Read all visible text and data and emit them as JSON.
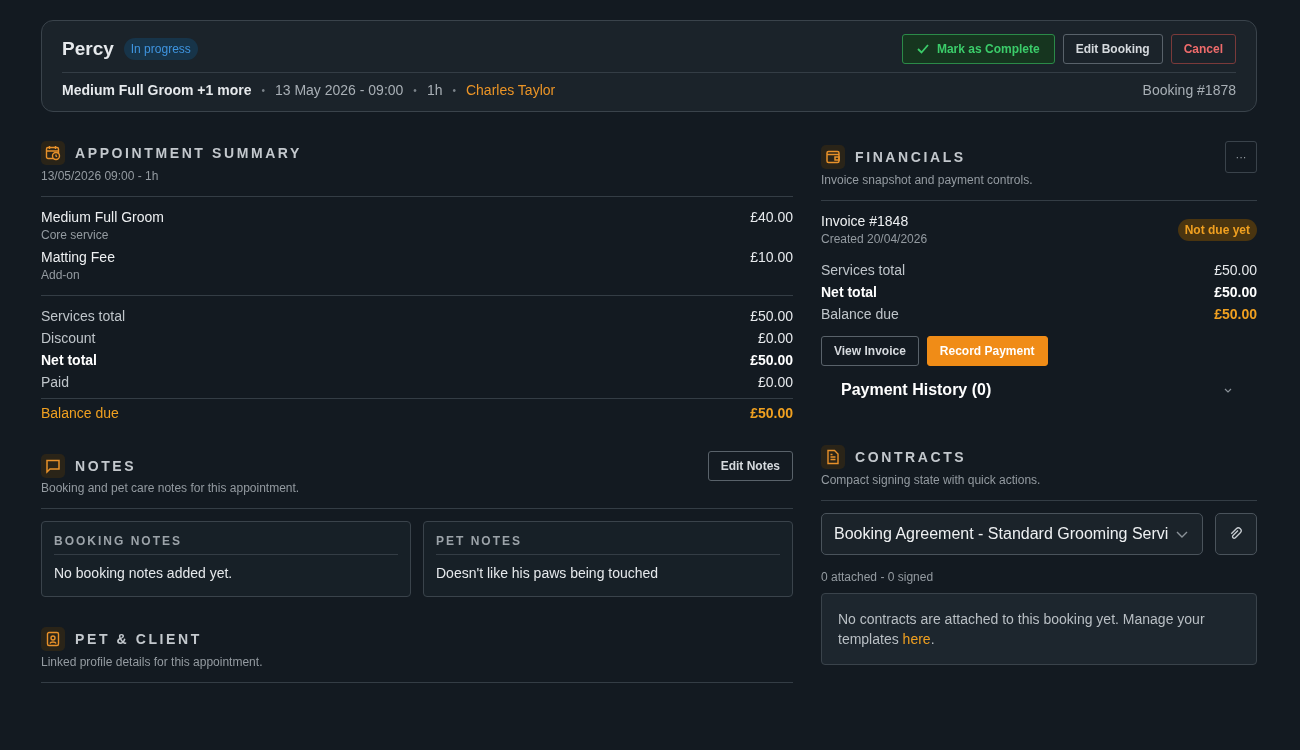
{
  "header": {
    "pet_name": "Percy",
    "status": {
      "label": "In progress",
      "kind": "info"
    },
    "actions": [
      {
        "label": "Mark as Complete",
        "kind": "success"
      },
      {
        "label": "Edit Booking",
        "kind": "default"
      },
      {
        "label": "Cancel",
        "kind": "danger"
      }
    ],
    "service": "Medium Full Groom +1 more",
    "date": "13 May 2026 - 09:00",
    "duration": "1h",
    "staff": "Charles Taylor",
    "separator": "•",
    "booking_ref": "Booking #1878"
  },
  "appointment_summary": {
    "title": "APPOINTMENT SUMMARY",
    "subtitle": "13/05/2026 09:00 - 1h",
    "services": [
      {
        "name": "Medium Full Groom",
        "type": "Core service",
        "price": "£40.00"
      },
      {
        "name": "Matting Fee",
        "type": "Add-on",
        "price": "£10.00"
      }
    ],
    "totals": [
      {
        "label": "Services total",
        "value": "£50.00",
        "kind": "plain"
      },
      {
        "label": "Discount",
        "value": "£0.00",
        "kind": "plain"
      },
      {
        "label": "Net total",
        "value": "£50.00",
        "kind": "bold"
      },
      {
        "label": "Paid",
        "value": "£0.00",
        "kind": "plain"
      }
    ],
    "balance": {
      "label": "Balance due",
      "value": "£50.00"
    }
  },
  "notes": {
    "title": "NOTES",
    "subtitle": "Booking and pet care notes for this appointment.",
    "edit_button": "Edit Notes",
    "cards": [
      {
        "title": "BOOKING NOTES",
        "text": "No booking notes added yet."
      },
      {
        "title": "PET NOTES",
        "text": "Doesn't like his paws being touched"
      }
    ]
  },
  "pet_client": {
    "title": "PET & CLIENT",
    "subtitle": "Linked profile details for this appointment."
  },
  "financials": {
    "title": "FINANCIALS",
    "subtitle": "Invoice snapshot and payment controls.",
    "more_button": "···",
    "invoice": "Invoice #1848",
    "created": "Created 20/04/2026",
    "status": {
      "label": "Not due yet",
      "kind": "warning"
    },
    "rows": [
      {
        "label": "Services total",
        "value": "£50.00",
        "kind": "plain"
      },
      {
        "label": "Net total",
        "value": "£50.00",
        "kind": "bold"
      },
      {
        "label": "Balance due",
        "value": "£50.00",
        "kind": "accent"
      }
    ],
    "buttons": [
      {
        "label": "View Invoice",
        "kind": "default"
      },
      {
        "label": "Record Payment",
        "kind": "primary"
      }
    ],
    "payment_history": {
      "label": "Payment History (0)",
      "expanded": false
    }
  },
  "contracts": {
    "title": "CONTRACTS",
    "subtitle": "Compact signing state with quick actions.",
    "template": "Booking Agreement - Standard Grooming Servi",
    "counts": "0 attached - 0 signed",
    "empty_text": "No contracts are attached to this booking yet. Manage your templates ",
    "link": "here",
    "end": "."
  }
}
